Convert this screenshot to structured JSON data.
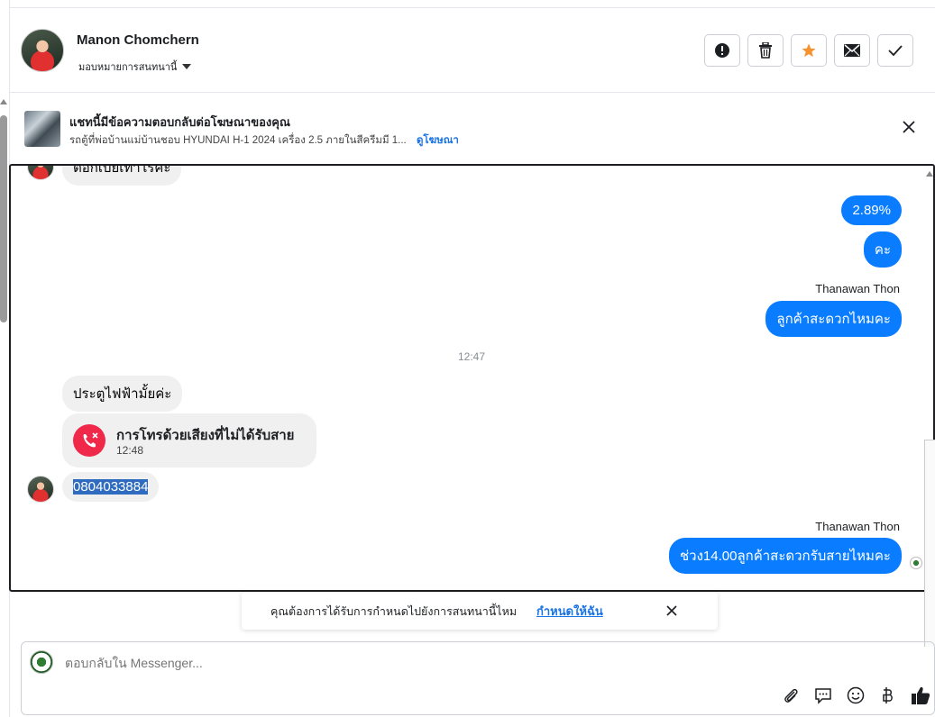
{
  "header": {
    "name": "Manon Chomchern",
    "assign_label": "มอบหมายการสนทนานี้",
    "actions": [
      "exclamation-icon",
      "trash-icon",
      "star-icon",
      "mail-icon",
      "check-icon"
    ]
  },
  "ad": {
    "title": "แชทนี้มีข้อความตอบกลับต่อโฆษณาของคุณ",
    "subtitle": "รถตู้ที่พ่อบ้านแม่บ้านชอบ HYUNDAI H-1 2024 เครื่อง 2.5 ภายในสีครีมมี 1...",
    "link": "ดูโฆษณา"
  },
  "messages": {
    "cut_off_incoming": "ต่อกเบยเทาไรคะ",
    "out_1": "2.89%",
    "out_2": "คะ",
    "sender_1": "Thanawan Thon",
    "out_3": "ลูกค้าสะดวกไหมคะ",
    "time_1": "12:47",
    "in_1": "ประตูไฟฟ้ามั้ยค่ะ",
    "call_title": "การโทรด้วยเสียงที่ไม่ได้รับสาย",
    "call_time": "12:48",
    "in_2": "0804033884",
    "sender_2": "Thanawan Thon",
    "out_4": "ช่วง14.00ลูกค้าสะดวกรับสายไหมคะ"
  },
  "toast": {
    "text": "คุณต้องการได้รับการกำหนดไปยังการสนทนานี้ไหม",
    "link": "กำหนดให้ฉัน"
  },
  "composer": {
    "placeholder": "ตอบกลับใน Messenger...",
    "tools": [
      "paperclip-icon",
      "chat-bubble-icon",
      "emoji-icon",
      "baht-icon",
      "thumbs-up-icon"
    ]
  },
  "colors": {
    "accent": "#0a7cff",
    "link": "#1b74e4",
    "star": "#f7932f",
    "missed_call": "#f0284a"
  }
}
